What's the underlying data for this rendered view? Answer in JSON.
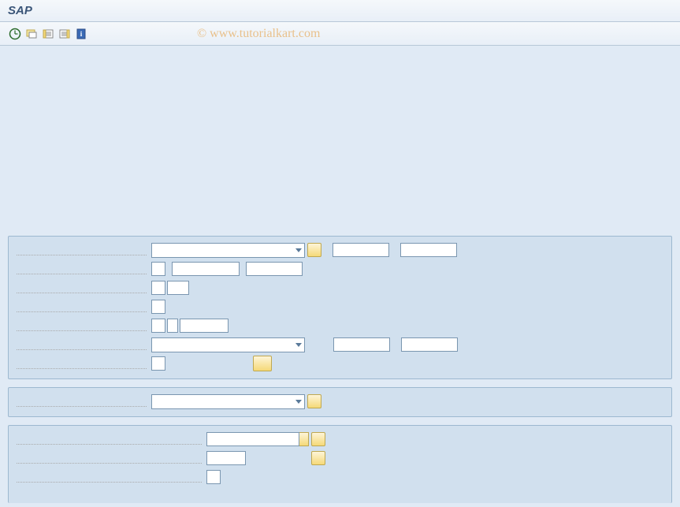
{
  "app": {
    "title": "SAP"
  },
  "watermark": {
    "text": "© www.tutorialkart.com"
  },
  "toolbar": {
    "icons": [
      {
        "name": "execute-icon"
      },
      {
        "name": "variant-icon"
      },
      {
        "name": "select-all-icon"
      },
      {
        "name": "deselect-all-icon"
      },
      {
        "name": "info-icon"
      }
    ]
  },
  "groups": {
    "group1": {
      "rows": [
        {
          "type": "dropdown-with-btns",
          "dropdown_w": 195,
          "btn_w": 18,
          "extra": [
            {
              "w": 72
            },
            {
              "w": 72
            }
          ]
        },
        {
          "type": "three-inputs",
          "w1": 18,
          "w2": 86,
          "w3": 72
        },
        {
          "type": "two-inputs",
          "w1": 18,
          "w2": 28
        },
        {
          "type": "one-input",
          "w1": 18
        },
        {
          "type": "three-inputs",
          "w1": 18,
          "w2": 14,
          "w3": 62
        },
        {
          "type": "dropdown-with-gap",
          "dropdown_w": 195,
          "extra": [
            {
              "w": 72
            },
            {
              "w": 72
            }
          ]
        },
        {
          "type": "one-input-btn",
          "w1": 18,
          "btn_gap": 120,
          "btn_w": 24
        }
      ]
    },
    "group2": {
      "rows": [
        {
          "type": "dropdown-with-btns",
          "dropdown_w": 195,
          "btn_w": 18
        }
      ]
    },
    "group3": {
      "rows": [
        {
          "type": "input-help-btn",
          "w1": 118,
          "btn_w": 18
        },
        {
          "type": "input-btn",
          "w1": 50,
          "btn_w": 18
        },
        {
          "type": "input-help",
          "w1": 18
        }
      ]
    }
  }
}
